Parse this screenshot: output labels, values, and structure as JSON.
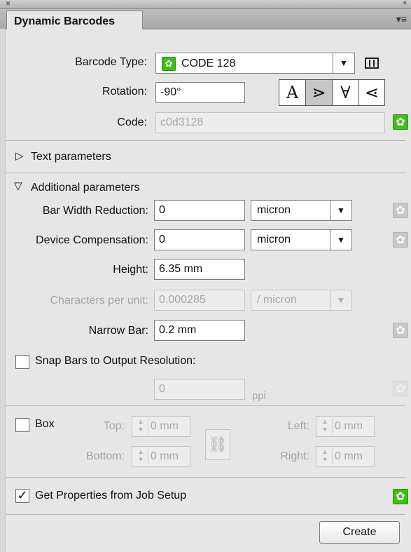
{
  "window": {
    "close_glyph": "×",
    "collapse_glyph": "‹‹"
  },
  "tab": {
    "label": "Dynamic Barcodes",
    "menu_glyph": "▾≡"
  },
  "barcode_type": {
    "label": "Barcode Type:",
    "value": "CODE 128",
    "arrow": "▼"
  },
  "rotation": {
    "label": "Rotation:",
    "value": "-90°",
    "buttons": [
      "A",
      "⋗",
      "∀",
      "⋖"
    ]
  },
  "code": {
    "label": "Code:",
    "value": "c0d3128"
  },
  "text_parameters": {
    "label": "Text parameters",
    "toggle": "▷"
  },
  "additional_parameters": {
    "label": "Additional parameters",
    "toggle": "▽",
    "bar_width_reduction": {
      "label": "Bar Width Reduction:",
      "value": "0",
      "unit": "micron"
    },
    "device_compensation": {
      "label": "Device Compensation:",
      "value": "0",
      "unit": "micron"
    },
    "height": {
      "label": "Height:",
      "value": "6.35 mm"
    },
    "characters_per_unit": {
      "label": "Characters per unit:",
      "value": "0.000285",
      "unit": "/ micron"
    },
    "narrow_bar": {
      "label": "Narrow Bar:",
      "value": "0.2 mm"
    },
    "snap_bars": {
      "label": "Snap Bars to Output Resolution:",
      "value": "0",
      "unit": "ppi"
    }
  },
  "box": {
    "label": "Box",
    "top": {
      "label": "Top:",
      "value": "0 mm"
    },
    "bottom": {
      "label": "Bottom:",
      "value": "0 mm"
    },
    "left": {
      "label": "Left:",
      "value": "0 mm"
    },
    "right": {
      "label": "Right:",
      "value": "0 mm"
    },
    "spin_glyph": "▲\n▼",
    "link_glyph": "⛓"
  },
  "job_setup": {
    "label": "Get Properties from Job Setup",
    "checked": "✓"
  },
  "create_button": "Create",
  "icons": {
    "gear": "✿"
  },
  "colors": {
    "accent_green": "#3fbf18",
    "panel_bg": "#e6e6e6"
  }
}
